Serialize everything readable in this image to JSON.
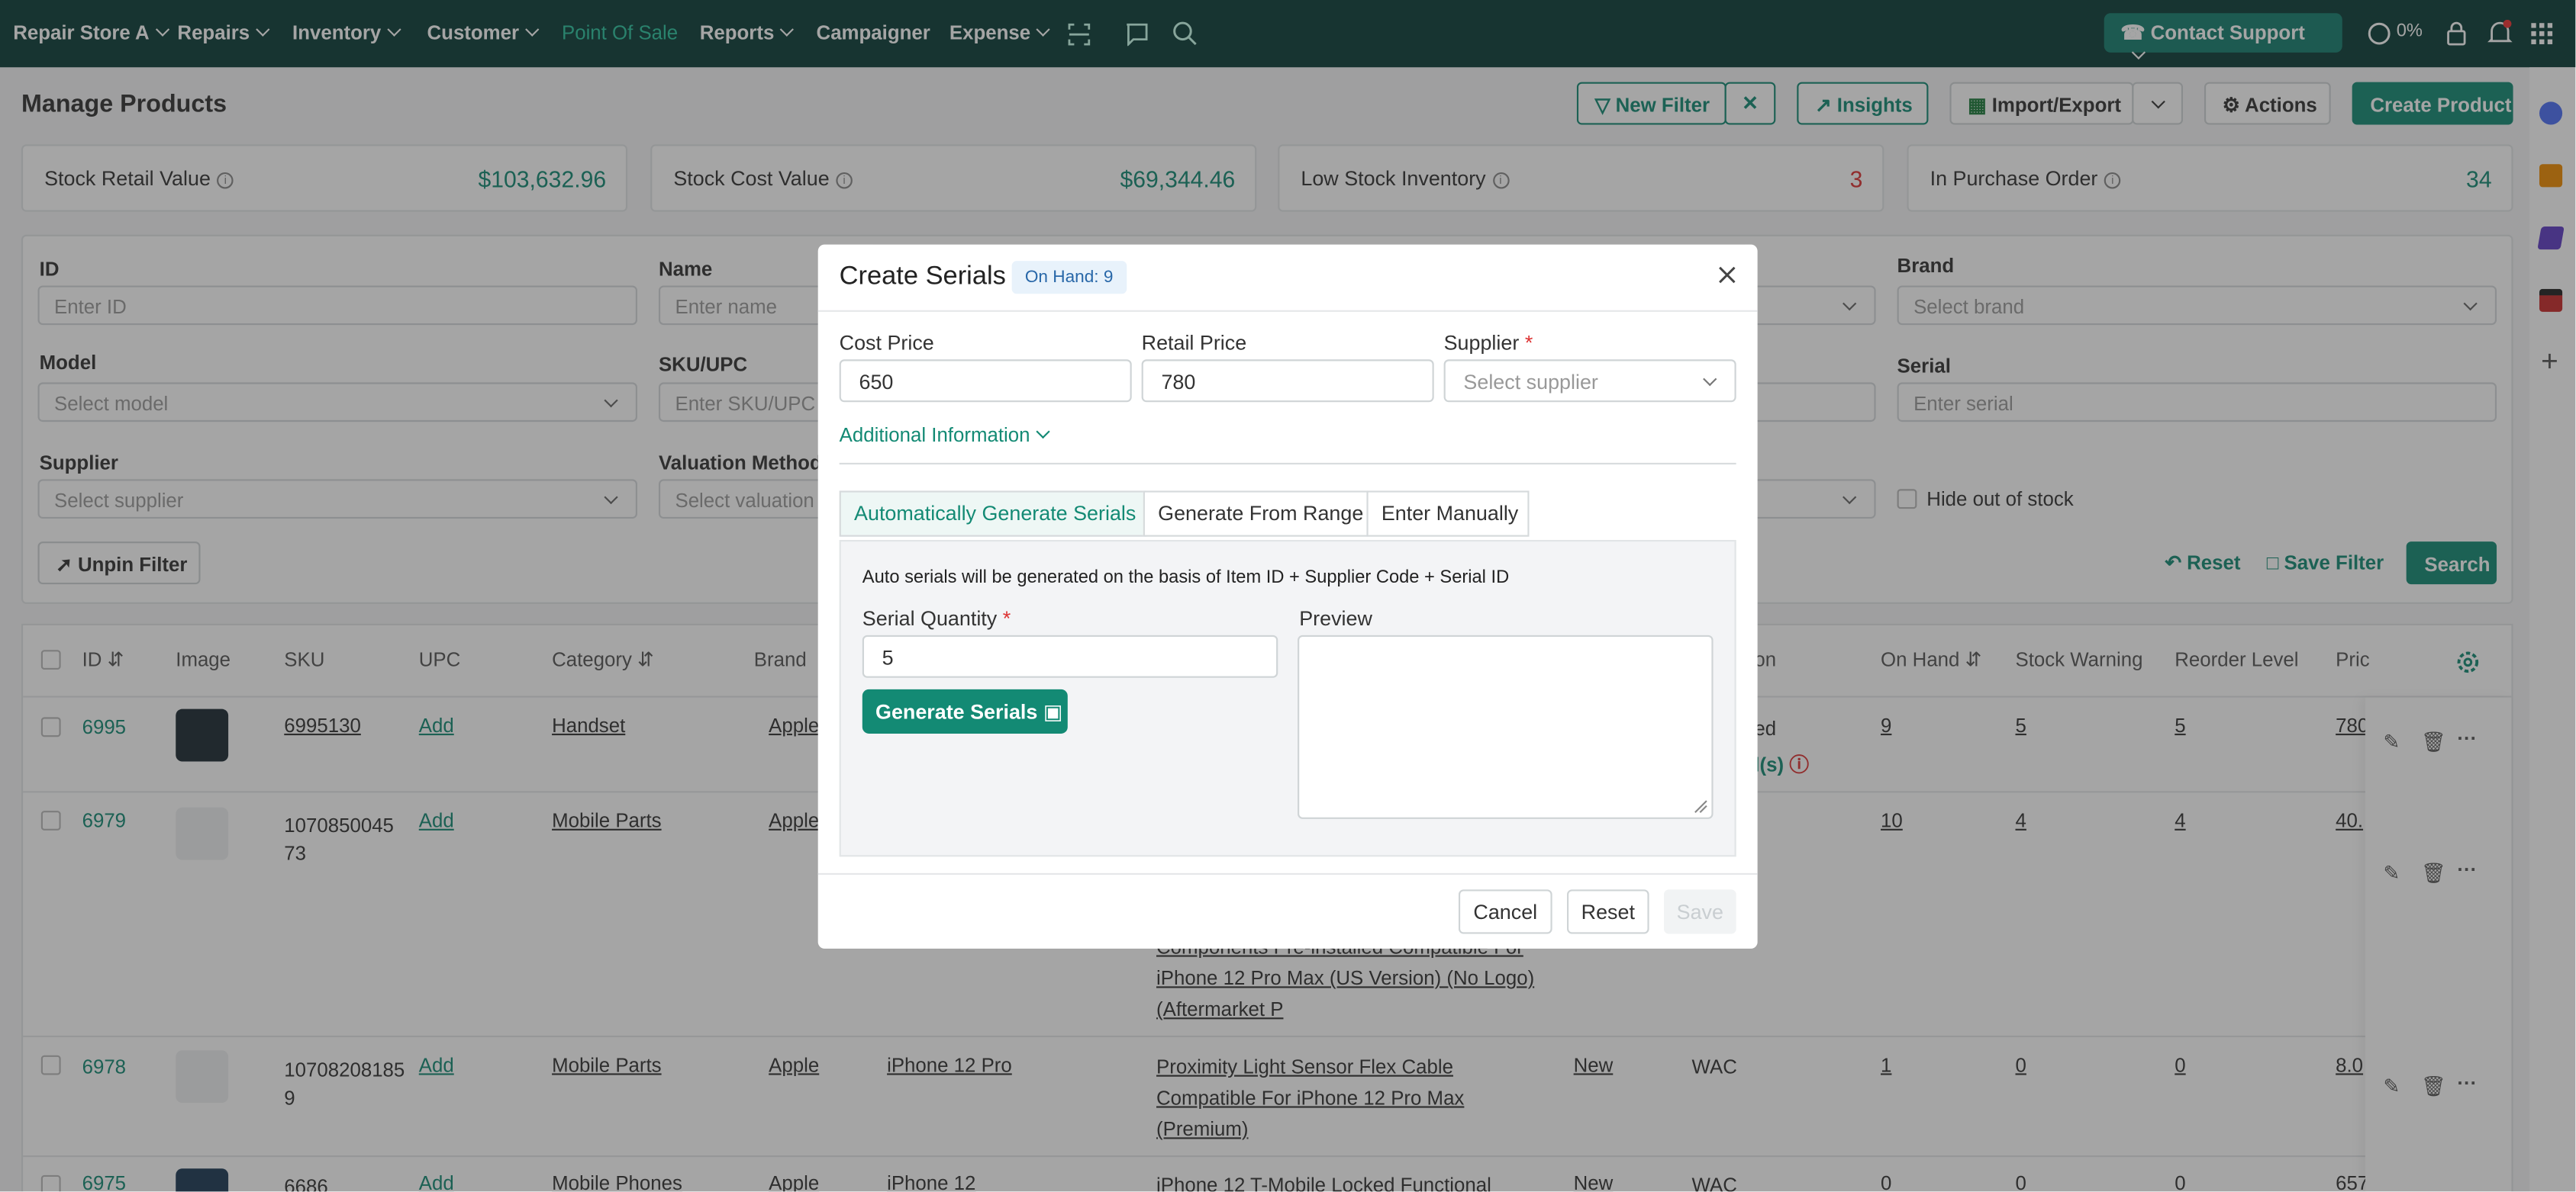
{
  "nav": {
    "store": "Repair Store A",
    "items": [
      "Repairs",
      "Inventory",
      "Customer",
      "Point Of Sale",
      "Reports",
      "Campaigner",
      "Expense"
    ],
    "support": "Contact Support",
    "progress": "0%"
  },
  "page": {
    "title": "Manage Products",
    "new_filter": "New Filter",
    "insights": "Insights",
    "import_export": "Import/Export",
    "actions": "Actions",
    "create_product": "Create Product"
  },
  "stats": [
    {
      "label": "Stock Retail Value",
      "value": "$103,632.96"
    },
    {
      "label": "Stock Cost Value",
      "value": "$69,344.46"
    },
    {
      "label": "Low Stock Inventory",
      "value": "3"
    },
    {
      "label": "In Purchase Order",
      "value": "34"
    }
  ],
  "filters": {
    "id_label": "ID",
    "id_ph": "Enter ID",
    "name_label": "Name",
    "name_ph": "Enter name",
    "brand_label": "Brand",
    "brand_ph": "Select brand",
    "model_label": "Model",
    "model_ph": "Select model",
    "sku_label": "SKU/UPC",
    "sku_ph": "Enter SKU/UPC",
    "serial_label": "Serial",
    "serial_ph": "Enter serial",
    "supplier_label": "Supplier",
    "supplier_ph": "Select supplier",
    "valuation_label": "Valuation Method",
    "valuation_ph": "Select valuation",
    "hide_oos": "Hide out of stock",
    "unpin": "Unpin Filter",
    "reset": "Reset",
    "save_filter": "Save Filter",
    "search": "Search"
  },
  "table": {
    "headers": {
      "id": "ID",
      "image": "Image",
      "sku": "SKU",
      "upc": "UPC",
      "category": "Category",
      "brand": "Brand",
      "condition": "on",
      "on_hand": "On Hand",
      "stock_warning": "Stock Warning",
      "reorder": "Reorder Level",
      "price": "Pric"
    },
    "rows": [
      {
        "id": "6995",
        "sku": "6995130",
        "upc": "Add",
        "category": "Handset",
        "brand": "Apple",
        "cond_a": "ed",
        "cond_b": "l(s)",
        "on_hand": "9",
        "warn": "5",
        "reorder": "5",
        "price": "780"
      },
      {
        "id": "6979",
        "sku1": "1070850045",
        "sku2": "73",
        "upc": "Add",
        "category": "Mobile Parts",
        "brand": "Apple",
        "name1": "Components Pre-installed Compatible For",
        "name2": "iPhone 12 Pro Max (US Version) (No Logo)",
        "name3": "(Aftermarket P",
        "on_hand": "10",
        "warn": "4",
        "reorder": "4",
        "price": "40."
      },
      {
        "id": "6978",
        "sku1": "10708208185",
        "sku2": "9",
        "upc": "Add",
        "category": "Mobile Parts",
        "brand": "Apple",
        "model": "iPhone 12 Pro",
        "name1": "Proximity Light Sensor Flex Cable",
        "name2": "Compatible For iPhone 12 Pro Max",
        "name3": "(Premium)",
        "cond": "New",
        "val": "WAC",
        "on_hand": "1",
        "warn": "0",
        "reorder": "0",
        "price": "8.0"
      },
      {
        "id": "6975",
        "sku": "6686",
        "upc": "Add",
        "category": "Mobile Phones",
        "brand": "Apple",
        "model": "iPhone 12",
        "name1": "iPhone 12  T-Mobile Locked  Functional",
        "cond": "New",
        "val": "WAC",
        "on_hand": "0",
        "warn": "0",
        "reorder": "0",
        "price": "657"
      }
    ]
  },
  "modal": {
    "title": "Create Serials",
    "badge": "On Hand: 9",
    "cost_label": "Cost Price",
    "cost_value": "650",
    "retail_label": "Retail Price",
    "retail_value": "780",
    "supplier_label": "Supplier",
    "supplier_ph": "Select supplier",
    "additional": "Additional Information",
    "tabs": [
      "Automatically Generate Serials",
      "Generate From Range",
      "Enter Manually"
    ],
    "note": "Auto serials will be generated on the basis of Item ID + Supplier Code + Serial ID",
    "qty_label": "Serial Quantity",
    "qty_value": "5",
    "preview_label": "Preview",
    "generate": "Generate Serials",
    "cancel": "Cancel",
    "reset": "Reset",
    "save": "Save"
  }
}
